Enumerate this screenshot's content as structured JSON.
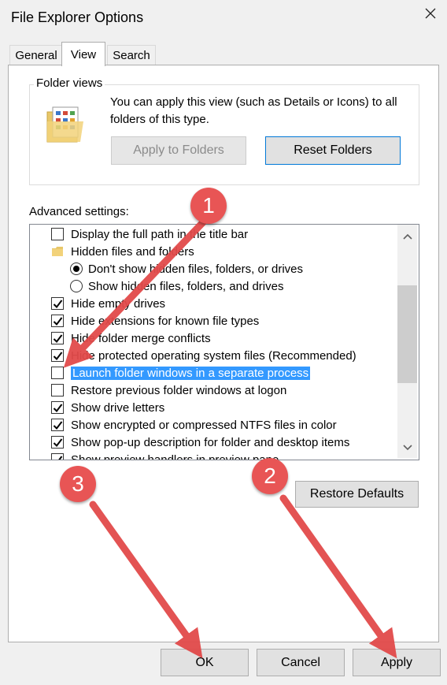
{
  "window": {
    "title": "File Explorer Options"
  },
  "tabs": [
    "General",
    "View",
    "Search"
  ],
  "folder_views": {
    "label": "Folder views",
    "description": "You can apply this view (such as Details or Icons) to all folders of this type.",
    "apply_label": "Apply to Folders",
    "reset_label": "Reset Folders"
  },
  "advanced": {
    "label": "Advanced settings:",
    "items": [
      {
        "type": "checkbox",
        "checked": false,
        "label": "Display the full path in the title bar"
      },
      {
        "type": "folder",
        "label": "Hidden files and folders"
      },
      {
        "type": "radio",
        "checked": true,
        "label": "Don't show hidden files, folders, or drives"
      },
      {
        "type": "radio",
        "checked": false,
        "label": "Show hidden files, folders, and drives"
      },
      {
        "type": "checkbox",
        "checked": true,
        "label": "Hide empty drives"
      },
      {
        "type": "checkbox",
        "checked": true,
        "label": "Hide extensions for known file types"
      },
      {
        "type": "checkbox",
        "checked": true,
        "label": "Hide folder merge conflicts"
      },
      {
        "type": "checkbox",
        "checked": true,
        "label": "Hide protected operating system files (Recommended)"
      },
      {
        "type": "checkbox",
        "checked": false,
        "selected": true,
        "label": "Launch folder windows in a separate process"
      },
      {
        "type": "checkbox",
        "checked": false,
        "label": "Restore previous folder windows at logon"
      },
      {
        "type": "checkbox",
        "checked": true,
        "label": "Show drive letters"
      },
      {
        "type": "checkbox",
        "checked": true,
        "label": "Show encrypted or compressed NTFS files in color"
      },
      {
        "type": "checkbox",
        "checked": true,
        "label": "Show pop-up description for folder and desktop items"
      },
      {
        "type": "checkbox",
        "checked": true,
        "label": "Show preview handlers in preview pane"
      }
    ]
  },
  "restore_defaults_label": "Restore Defaults",
  "footer": {
    "ok": "OK",
    "cancel": "Cancel",
    "apply": "Apply"
  },
  "annotations": [
    "1",
    "2",
    "3"
  ],
  "colors": {
    "selection": "#3399ff",
    "annotation": "#e85555"
  }
}
